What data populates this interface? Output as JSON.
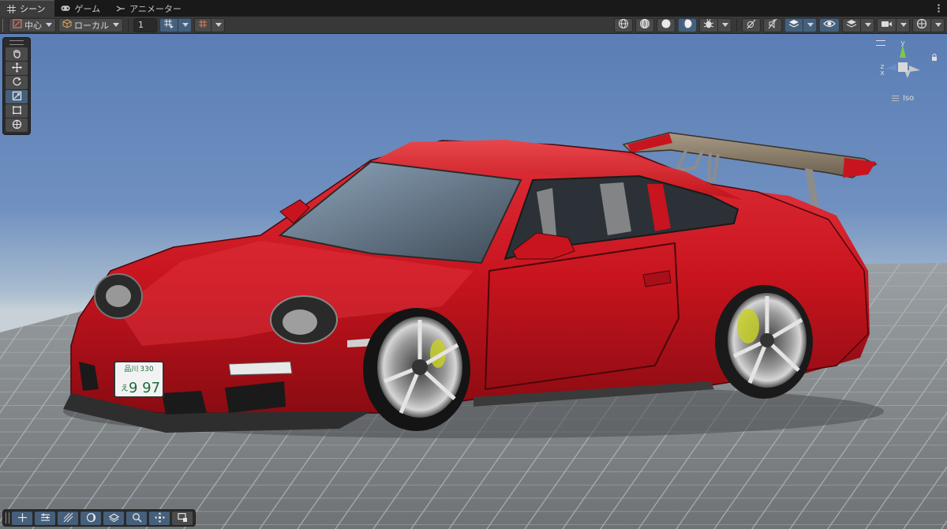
{
  "tabs": [
    {
      "label": "シーン",
      "icon": "grid-icon",
      "active": true
    },
    {
      "label": "ゲーム",
      "icon": "gamepad-icon",
      "active": false
    },
    {
      "label": "アニメーター",
      "icon": "animator-icon",
      "active": false
    }
  ],
  "toolbar": {
    "pivot_label": "中心",
    "space_label": "ローカル",
    "grid_size_value": "1"
  },
  "gizmo": {
    "axis_y": "y",
    "axis_z": "z",
    "axis_x": "x",
    "projection_label": "Iso"
  },
  "license_plate": {
    "region": "品川",
    "class_number": "330",
    "hiragana": "え",
    "number": "9 97"
  },
  "colors": {
    "accent": "#46607c",
    "car_body": "#c8141e",
    "sky_top": "#5b7fb6",
    "sky_horizon": "#bcc9d8"
  }
}
